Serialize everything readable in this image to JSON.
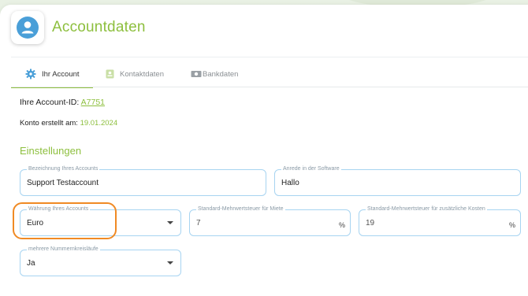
{
  "header": {
    "title": "Accountdaten",
    "avatar_icon": "user-avatar-icon"
  },
  "tabs": [
    {
      "label": "Ihr Account",
      "icon": "gear-icon",
      "active": true
    },
    {
      "label": "Kontaktdaten",
      "icon": "contact-card-icon",
      "active": false
    },
    {
      "label": "Bankdaten",
      "icon": "money-icon",
      "active": false
    }
  ],
  "account": {
    "id_label": "Ihre Account-ID:",
    "id_value": "A7751",
    "created_label": "Konto erstellt am:",
    "created_value": "19.01.2024"
  },
  "settings": {
    "title": "Einstellungen",
    "fields": {
      "account_name": {
        "label": "Bezeichnung Ihres Accounts",
        "value": "Support Testaccount"
      },
      "greeting": {
        "label": "Anrede in der Software",
        "value": "Hallo"
      },
      "currency": {
        "label": "Währung Ihres Accounts",
        "value": "Euro"
      },
      "vat_rent": {
        "label": "Standard-Mehrwertsteuer für Miete",
        "value": "7",
        "suffix": "%"
      },
      "vat_extra": {
        "label": "Standard-Mehrwertsteuer für zusätzliche Kosten",
        "value": "19",
        "suffix": "%"
      },
      "number_ranges": {
        "label": "mehrere Nummernkreisläufe",
        "value": "Ja"
      }
    }
  },
  "colors": {
    "accent": "#8dbf3e",
    "field_border": "#a7d4f1",
    "highlight": "#f08a24",
    "avatar": "#4a9fd8"
  }
}
